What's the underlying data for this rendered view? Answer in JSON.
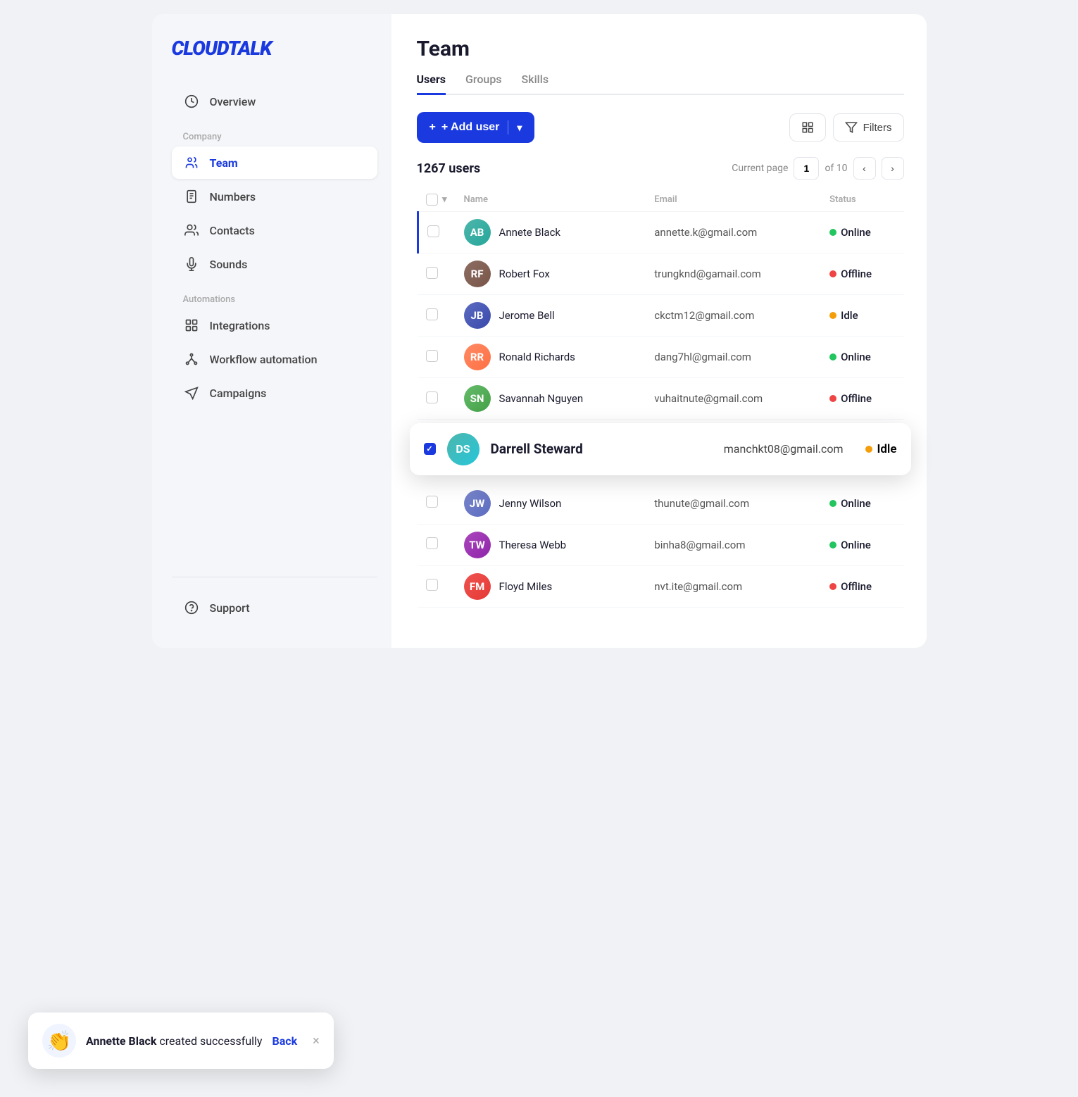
{
  "app": {
    "logo": "CLOUDTALK"
  },
  "sidebar": {
    "overview_label": "Overview",
    "company_section": "Company",
    "team_label": "Team",
    "numbers_label": "Numbers",
    "contacts_label": "Contacts",
    "sounds_label": "Sounds",
    "automations_section": "Automations",
    "integrations_label": "Integrations",
    "workflow_automation_label": "Workflow automation",
    "campaigns_label": "Campaigns",
    "support_label": "Support"
  },
  "main": {
    "page_title": "Team",
    "tabs": [
      {
        "label": "Users",
        "active": true
      },
      {
        "label": "Groups",
        "active": false
      },
      {
        "label": "Skills",
        "active": false
      }
    ],
    "add_user_btn": "+ Add user",
    "filters_btn": "Filters",
    "users_count": "1267 users",
    "pagination": {
      "current_page_label": "Current page",
      "page": "1",
      "of_label": "of 10"
    },
    "table": {
      "columns": [
        "Name",
        "Email",
        "Status"
      ],
      "rows": [
        {
          "name": "Annete Black",
          "email": "annette.k@gmail.com",
          "status": "Online",
          "status_type": "online",
          "av_color": "av-teal",
          "selected": false,
          "first": true
        },
        {
          "name": "Robert Fox",
          "email": "trungknd@gamail.com",
          "status": "Offline",
          "status_type": "offline",
          "av_color": "av-brown",
          "selected": false
        },
        {
          "name": "Jerome Bell",
          "email": "ckctm12@gmail.com",
          "status": "Idle",
          "status_type": "idle",
          "av_color": "av-blue",
          "selected": false
        },
        {
          "name": "Ronald Richards",
          "email": "dang7hl@gmail.com",
          "status": "Online",
          "status_type": "online",
          "av_color": "av-orange",
          "selected": false
        },
        {
          "name": "Savannah Nguyen",
          "email": "vuhaitnute@gmail.com",
          "status": "Offline",
          "status_type": "offline",
          "av_color": "av-green",
          "selected": false
        },
        {
          "name": "Jenny Wilson",
          "email": "thunute@gmail.com",
          "status": "Online",
          "status_type": "online",
          "av_color": "av-indigo",
          "selected": false
        },
        {
          "name": "Theresa Webb",
          "email": "binha8@gmail.com",
          "status": "Online",
          "status_type": "online",
          "av_color": "av-purple",
          "selected": false
        },
        {
          "name": "Floyd Miles",
          "email": "nvt.ite@gmail.com",
          "status": "Offline",
          "status_type": "offline",
          "av_color": "av-red",
          "selected": false
        }
      ],
      "floating_row": {
        "name": "Darrell Steward",
        "email": "manchkt08@gmail.com",
        "status": "Idle",
        "status_type": "idle",
        "av_color": "av-cyan",
        "checked": true
      }
    }
  },
  "toast": {
    "icon": "👏",
    "message_bold": "Annette Black",
    "message_rest": " created successfully",
    "back_label": "Back",
    "close_label": "×"
  },
  "colors": {
    "brand_blue": "#1a3ae0",
    "online": "#22c55e",
    "offline": "#ef4444",
    "idle": "#f59e0b"
  }
}
